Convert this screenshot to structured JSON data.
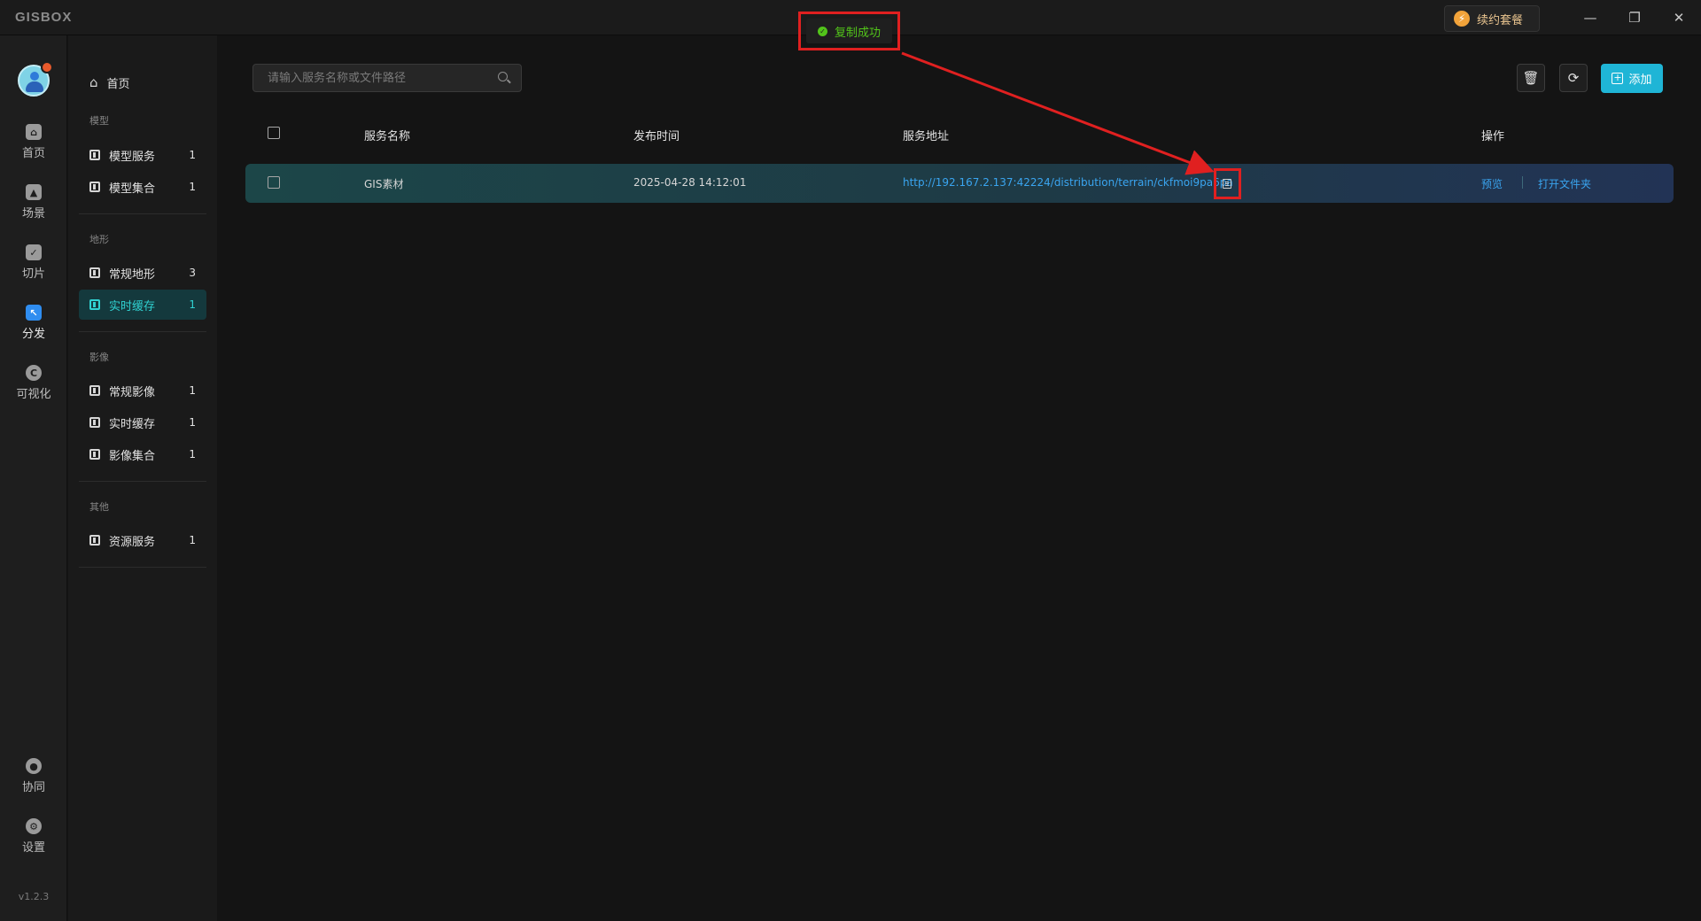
{
  "app": {
    "logo": "GISBOX",
    "renew_label": "续约套餐",
    "version": "v1.2.3"
  },
  "toast": {
    "text": "复制成功"
  },
  "rail": {
    "items": [
      {
        "label": "首页",
        "icon": "home-icon"
      },
      {
        "label": "场景",
        "icon": "scene-icon"
      },
      {
        "label": "切片",
        "icon": "tile-icon"
      },
      {
        "label": "分发",
        "icon": "distribute-icon"
      },
      {
        "label": "可视化",
        "icon": "visualize-icon"
      },
      {
        "label": "协同",
        "icon": "collaborate-icon"
      },
      {
        "label": "设置",
        "icon": "settings-icon"
      }
    ],
    "active": "分发"
  },
  "subnav": {
    "home": "首页",
    "groups": [
      {
        "title": "模型",
        "items": [
          {
            "label": "模型服务",
            "count": "1"
          },
          {
            "label": "模型集合",
            "count": "1"
          }
        ]
      },
      {
        "title": "地形",
        "items": [
          {
            "label": "常规地形",
            "count": "3"
          },
          {
            "label": "实时缓存",
            "count": "1"
          }
        ]
      },
      {
        "title": "影像",
        "items": [
          {
            "label": "常规影像",
            "count": "1"
          },
          {
            "label": "实时缓存",
            "count": "1"
          },
          {
            "label": "影像集合",
            "count": "1"
          }
        ]
      },
      {
        "title": "其他",
        "items": [
          {
            "label": "资源服务",
            "count": "1"
          }
        ]
      }
    ],
    "active_item": "地形/实时缓存"
  },
  "search": {
    "placeholder": "请输入服务名称或文件路径",
    "value": ""
  },
  "toolbar": {
    "add_label": "添加"
  },
  "table": {
    "columns": [
      "服务名称",
      "发布时间",
      "服务地址",
      "操作"
    ],
    "rows": [
      {
        "name": "GIS素材",
        "time": "2025-04-28 14:12:01",
        "url": "http://192.167.2.137:42224/distribution/terrain/ckfmoi9pa6pa",
        "actions": [
          "预览",
          "打开文件夹"
        ]
      }
    ]
  },
  "colors": {
    "accent": "#30d1d1",
    "link": "#3aa5f0",
    "success": "#52c41a",
    "annotation": "#e02020",
    "primary_button": "#1fb5d6"
  }
}
